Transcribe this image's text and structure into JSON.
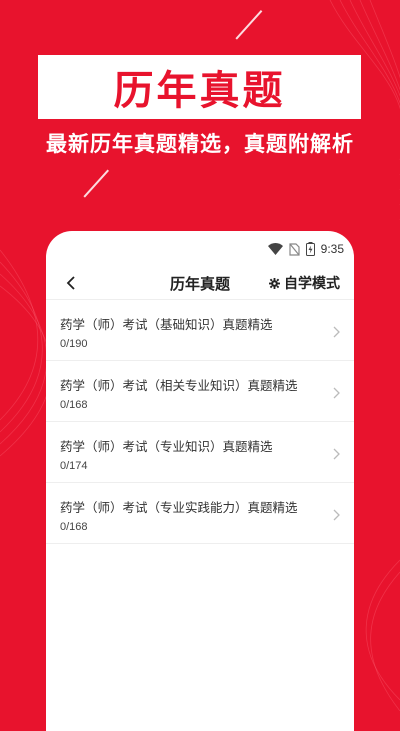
{
  "colors": {
    "brand_red": "#e8132d",
    "white": "#ffffff",
    "text": "#333333",
    "muted": "#bbbbbb"
  },
  "hero": {
    "title": "历年真题",
    "subtitle": "最新历年真题精选，真题附解析"
  },
  "status_bar": {
    "time": "9:35",
    "icons": [
      "wifi-icon",
      "no-sim-icon",
      "battery-charging-icon"
    ]
  },
  "navbar": {
    "back_icon": "chevron-left-icon",
    "title": "历年真题",
    "mode_icon": "gear-icon",
    "mode_label": "自学模式"
  },
  "list": {
    "items": [
      {
        "title": "药学（师）考试（基础知识）真题精选",
        "progress": "0/190"
      },
      {
        "title": "药学（师）考试（相关专业知识）真题精选",
        "progress": "0/168"
      },
      {
        "title": "药学（师）考试（专业知识）真题精选",
        "progress": "0/174"
      },
      {
        "title": "药学（师）考试（专业实践能力）真题精选",
        "progress": "0/168"
      }
    ]
  }
}
